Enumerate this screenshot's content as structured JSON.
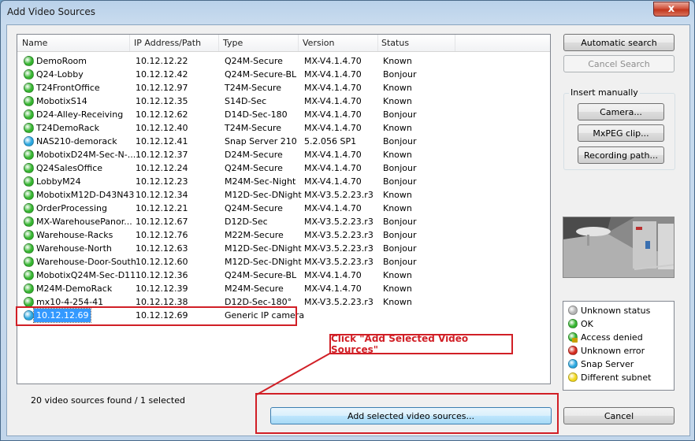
{
  "window": {
    "title": "Add Video Sources",
    "close_glyph": "x"
  },
  "list": {
    "columns": [
      "Name",
      "IP Address/Path",
      "Type",
      "Version",
      "Status"
    ],
    "rows": [
      {
        "name": "DemoRoom",
        "ip": "10.12.12.22",
        "type": "Q24M-Secure",
        "version": "MX-V4.1.4.70",
        "status": "Known",
        "dot": "#35b52f"
      },
      {
        "name": "Q24-Lobby",
        "ip": "10.12.12.42",
        "type": "Q24M-Secure-BL",
        "version": "MX-V4.1.4.70",
        "status": "Bonjour",
        "dot": "#35b52f"
      },
      {
        "name": "T24FrontOffice",
        "ip": "10.12.12.97",
        "type": "T24M-Secure",
        "version": "MX-V4.1.4.70",
        "status": "Known",
        "dot": "#35b52f"
      },
      {
        "name": "MobotixS14",
        "ip": "10.12.12.35",
        "type": "S14D-Sec",
        "version": "MX-V4.1.4.70",
        "status": "Known",
        "dot": "#35b52f"
      },
      {
        "name": "D24-Alley-Receiving",
        "ip": "10.12.12.62",
        "type": "D14D-Sec-180",
        "version": "MX-V4.1.4.70",
        "status": "Bonjour",
        "dot": "#35b52f"
      },
      {
        "name": "T24DemoRack",
        "ip": "10.12.12.40",
        "type": "T24M-Secure",
        "version": "MX-V4.1.4.70",
        "status": "Known",
        "dot": "#35b52f"
      },
      {
        "name": "NAS210-demorack",
        "ip": "10.12.12.41",
        "type": "Snap Server 210",
        "version": "5.2.056 SP1",
        "status": "Bonjour",
        "dot": "#2aa7e0"
      },
      {
        "name": "MobotixD24M-Sec-N-...",
        "ip": "10.12.12.37",
        "type": "D24M-Secure",
        "version": "MX-V4.1.4.70",
        "status": "Known",
        "dot": "#35b52f"
      },
      {
        "name": "Q24SalesOffice",
        "ip": "10.12.12.24",
        "type": "Q24M-Secure",
        "version": "MX-V4.1.4.70",
        "status": "Bonjour",
        "dot": "#35b52f"
      },
      {
        "name": "LobbyM24",
        "ip": "10.12.12.23",
        "type": "M24M-Sec-Night",
        "version": "MX-V4.1.4.70",
        "status": "Bonjour",
        "dot": "#35b52f"
      },
      {
        "name": "MobotixM12D-D43N43",
        "ip": "10.12.12.34",
        "type": "M12D-Sec-DNight",
        "version": "MX-V3.5.2.23.r3",
        "status": "Known",
        "dot": "#35b52f"
      },
      {
        "name": "OrderProcessing",
        "ip": "10.12.12.21",
        "type": "Q24M-Secure",
        "version": "MX-V4.1.4.70",
        "status": "Known",
        "dot": "#35b52f"
      },
      {
        "name": "MX-WarehousePanor...",
        "ip": "10.12.12.67",
        "type": "D12D-Sec",
        "version": "MX-V3.5.2.23.r3",
        "status": "Bonjour",
        "dot": "#35b52f"
      },
      {
        "name": "Warehouse-Racks",
        "ip": "10.12.12.76",
        "type": "M22M-Secure",
        "version": "MX-V3.5.2.23.r3",
        "status": "Bonjour",
        "dot": "#35b52f"
      },
      {
        "name": "Warehouse-North",
        "ip": "10.12.12.63",
        "type": "M12D-Sec-DNight",
        "version": "MX-V3.5.2.23.r3",
        "status": "Bonjour",
        "dot": "#35b52f"
      },
      {
        "name": "Warehouse-Door-South",
        "ip": "10.12.12.60",
        "type": "M12D-Sec-DNight",
        "version": "MX-V3.5.2.23.r3",
        "status": "Bonjour",
        "dot": "#35b52f"
      },
      {
        "name": "MobotixQ24M-Sec-D11",
        "ip": "10.12.12.36",
        "type": "Q24M-Secure-BL",
        "version": "MX-V4.1.4.70",
        "status": "Known",
        "dot": "#35b52f"
      },
      {
        "name": "M24M-DemoRack",
        "ip": "10.12.12.39",
        "type": "M24M-Secure",
        "version": "MX-V4.1.4.70",
        "status": "Known",
        "dot": "#35b52f"
      },
      {
        "name": "mx10-4-254-41",
        "ip": "10.12.12.38",
        "type": "D12D-Sec-180°",
        "version": "MX-V3.5.2.23.r3",
        "status": "Known",
        "dot": "#35b52f"
      },
      {
        "name": "10.12.12.69",
        "ip": "10.12.12.69",
        "type": "Generic IP camera",
        "version": "",
        "status": "",
        "dot": "#2aa7e0",
        "selected": true
      }
    ]
  },
  "status_text": "20 video sources found / 1 selected",
  "buttons": {
    "automatic_search": "Automatic search",
    "cancel_search": "Cancel Search",
    "camera": "Camera...",
    "mxpeg_clip": "MxPEG clip...",
    "recording_path": "Recording path...",
    "add_selected": "Add selected video sources...",
    "cancel": "Cancel"
  },
  "insert_manually_label": "Insert manually",
  "legend": [
    {
      "label": "Unknown status",
      "color": "#b5b5b5"
    },
    {
      "label": "OK",
      "color": "#35b52f"
    },
    {
      "label": "Access denied",
      "color": "#35b52f"
    },
    {
      "label": "Unknown error",
      "color": "#d42a1e"
    },
    {
      "label": "Snap Server",
      "color": "#2aa7e0"
    },
    {
      "label": "Different subnet",
      "color": "#f2d81c"
    }
  ],
  "annotation": {
    "callout_text": "Click \"Add Selected Video Sources\"",
    "color": "#d11f26"
  }
}
